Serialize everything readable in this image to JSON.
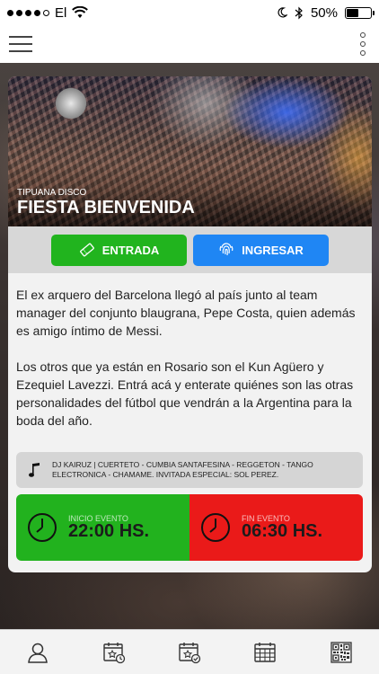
{
  "status_bar": {
    "carrier": "El",
    "battery_text": "50%",
    "battery_level": 0.5,
    "signal_bars": 4,
    "icons": [
      "wifi-icon",
      "moon-icon",
      "bluetooth-icon",
      "battery-icon"
    ]
  },
  "nav": {
    "icons": [
      "hamburger-menu-icon",
      "more-options-icon"
    ]
  },
  "event": {
    "venue": "Tipuana Disco",
    "title": "Fiesta Bienvenida"
  },
  "actions": {
    "ticket_label": "Entrada",
    "login_label": "Ingresar",
    "ticket_color": "#21b41e",
    "login_color": "#1f86f4"
  },
  "description": {
    "paragraphs": [
      "El ex arquero del Barcelona llegó al país junto al team manager del conjunto blaugrana, Pepe Costa, quien además es amigo íntimo de Messi.",
      "Los otros que ya están en Rosario son el Kun Agüero y Ezequiel Lavezzi. Entrá acá y enterate quiénes son las otras personalidades del fútbol que vendrán a la Argentina para la boda del año."
    ]
  },
  "music": {
    "text": "DJ KAIRUZ | CUERTETO - CUMBIA SANTAFESINA - REGGETON - TANGO ELECTRONICA - CHAMAME. INVITADA ESPECIAL: SOL PEREZ."
  },
  "times": {
    "start_label": "Inicio evento",
    "start_value": "22:00 HS.",
    "end_label": "Fin evento",
    "end_value": "06:30 HS.",
    "start_color": "#22b21e",
    "end_color": "#ea1a19"
  },
  "tabbar": {
    "items": [
      "profile-icon",
      "calendar-clock-icon",
      "calendar-check-icon",
      "calendar-grid-icon",
      "qr-code-icon"
    ]
  }
}
